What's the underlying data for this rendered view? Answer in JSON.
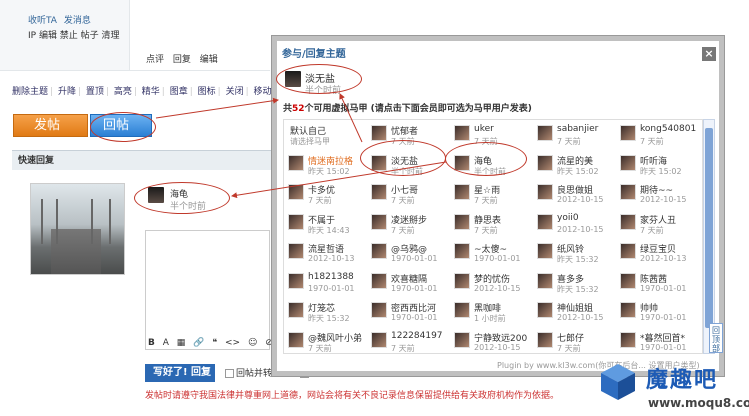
{
  "profile": {
    "rows": [
      "收听TA",
      "发消息",
      "IP 编辑 禁止 帖子 清理"
    ]
  },
  "post_tools": [
    "点评",
    "回复",
    "编辑"
  ],
  "mod_bar": [
    "删除主题",
    "升降",
    "置顶",
    "高亮",
    "精华",
    "图章",
    "图标",
    "关闭",
    "移动"
  ],
  "buttons": {
    "reply": "发帖",
    "reply2": "回帖"
  },
  "quick_reply": {
    "title": "快速回复",
    "submit": "写好了! 回复",
    "check1": "回帖并转播",
    "check2": "回帖后跳转到最后一页",
    "notice": "发帖时请遵守我国法律并尊重网上道德，网站会将有关不良记录信息保留提供给有关政府机构作为依据。"
  },
  "selected_mj": {
    "name": "海龟",
    "time": "半个时前"
  },
  "editor_toolbar": [
    "B",
    "A",
    "▦",
    "🔗",
    "❝",
    "<>",
    "☺",
    "⊘"
  ],
  "dialog": {
    "title": "参与/回复主题",
    "close": "×",
    "current": {
      "name": "淡无盐",
      "time": "半个时前"
    },
    "count_prefix": "共",
    "count_num": "52",
    "count_suffix": "个可用虚拟马甲 (请点击下面会员即可选为马甲用户发表)",
    "plugin": "Plugin by www.kl3w.com(你可在后台... 设置用户类型)",
    "to_top": "回顶部",
    "members": [
      {
        "name": "默认自己",
        "time": "请选择马甲"
      },
      {
        "name": "忧郁者",
        "time": "7 天前"
      },
      {
        "name": "uker",
        "time": "7 天前"
      },
      {
        "name": "sabanjier",
        "time": "7 天前"
      },
      {
        "name": "kong540801",
        "time": "7 天前"
      },
      {
        "name": "情迷南拉格",
        "time": "昨天 15:02"
      },
      {
        "name": "淡无盐",
        "time": "半个时前"
      },
      {
        "name": "海龟",
        "time": "半个时前"
      },
      {
        "name": "流星的美",
        "time": "昨天 15:02"
      },
      {
        "name": "听听海",
        "time": "昨天 15:02"
      },
      {
        "name": "卡多优",
        "time": "7 天前"
      },
      {
        "name": "小七哥",
        "time": "7 天前"
      },
      {
        "name": "星☆雨",
        "time": "7 天前"
      },
      {
        "name": "良思做姐",
        "time": "2012-10-15"
      },
      {
        "name": "期待~~",
        "time": "2012-10-15"
      },
      {
        "name": "不属于",
        "time": "昨天 14:43"
      },
      {
        "name": "凌迷掰步",
        "time": "7 天前"
      },
      {
        "name": "静思表",
        "time": "7 天前"
      },
      {
        "name": "yoii0",
        "time": "2012-10-15"
      },
      {
        "name": "家芬人丑",
        "time": "7 天前"
      },
      {
        "name": "流星哲语",
        "time": "2012-10-13"
      },
      {
        "name": "@乌鸦@",
        "time": "1970-01-01"
      },
      {
        "name": "~太傻~",
        "time": "1970-01-01"
      },
      {
        "name": "纸风铃",
        "time": "昨天 15:32"
      },
      {
        "name": "绿豆宝贝",
        "time": "2012-10-13"
      },
      {
        "name": "h1821388",
        "time": "1970-01-01"
      },
      {
        "name": "欢喜糖隔",
        "time": "1970-01-01"
      },
      {
        "name": "梦的忧伤",
        "time": "2012-10-15"
      },
      {
        "name": "喜多多",
        "time": "昨天 15:32"
      },
      {
        "name": "陈茜茜",
        "time": "1970-01-01"
      },
      {
        "name": "灯笼芯",
        "time": "昨天 15:32"
      },
      {
        "name": "密西西比河",
        "time": "1970-01-01"
      },
      {
        "name": "黑咖啡",
        "time": "1 小时前"
      },
      {
        "name": "神仙姐姐",
        "time": "2012-10-15"
      },
      {
        "name": "帅帅",
        "time": "1970-01-01"
      },
      {
        "name": "@魏风叶小弟",
        "time": "7 天前"
      },
      {
        "name": "122284197",
        "time": "7 天前"
      },
      {
        "name": "宁静致远200",
        "time": "2012-10-15"
      },
      {
        "name": "七郎仔",
        "time": "7 天前"
      },
      {
        "name": "*暮然回首*",
        "time": "1970-01-01"
      }
    ]
  },
  "watermark": {
    "name": "魔趣吧",
    "url": "www.moqu8.com"
  },
  "colors": {
    "accent": "#336699",
    "annotation": "#c0392b",
    "reply_orange": "#e07a15",
    "reply_blue": "#2b7fd4"
  }
}
